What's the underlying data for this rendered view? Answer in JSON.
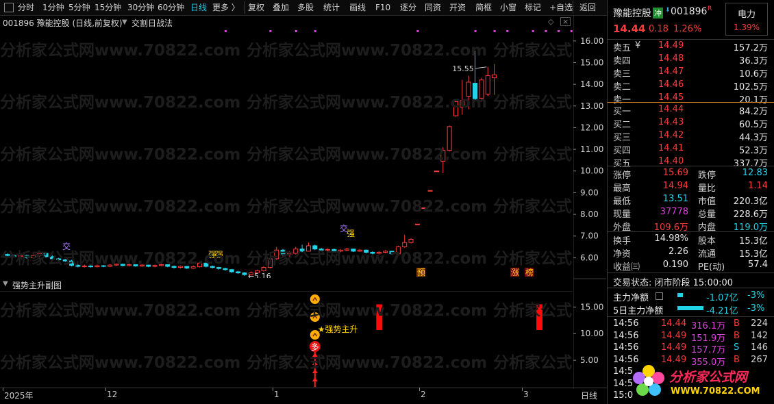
{
  "toolbar": {
    "items": [
      "分时",
      "1分钟",
      "5分钟",
      "15分钟",
      "30分钟",
      "60分钟",
      "日线",
      "更多 〉",
      "复权",
      "叠加",
      "多股",
      "统计",
      "画线",
      "F10",
      "逐分",
      "同资",
      "开资",
      "简框",
      "小窗",
      "标记",
      "+自选",
      "返回"
    ],
    "active": "日线"
  },
  "chart_header": {
    "code_title": "001896 豫能控股 (日线,前复权)",
    "indicator": "交割日战法"
  },
  "sub_header": {
    "title": "强势主升副图"
  },
  "watermark": "分析家公式网www.70822.com",
  "main_chart": {
    "y_ticks": [
      "16.00",
      "15.00",
      "14.00",
      "13.00",
      "12.00",
      "11.00",
      "10.00",
      "9.00",
      "8.00",
      "7.00",
      "6.00"
    ],
    "high_label": "15.55",
    "low_label": "5.16",
    "labels": {
      "jiao1": "交",
      "jiao2": "交",
      "qiang1": "强",
      "qiang2": "强",
      "qiang3": "强",
      "yu": "预",
      "zhang": "涨",
      "wan": "榜"
    }
  },
  "sub_chart": {
    "y_ticks": [
      "15.00",
      "10.00",
      "5.00"
    ],
    "signal_label": "★强势主升",
    "duo": "多"
  },
  "x_axis": {
    "labels": [
      "2025年",
      "12",
      "1",
      "2",
      "3"
    ],
    "period": "日线"
  },
  "quote": {
    "name": "豫能控股",
    "badge": "冲",
    "code": "001896",
    "r_mark": "R",
    "sector": "电力",
    "sector_pct": "1.39%",
    "price": "14.44",
    "change": "0.18",
    "pct": "1.26%",
    "asks": [
      {
        "label": "卖五",
        "mark": "¥",
        "price": "14.49",
        "vol": "157.2万"
      },
      {
        "label": "卖四",
        "mark": "",
        "price": "14.48",
        "vol": "36.3万"
      },
      {
        "label": "卖三",
        "mark": "",
        "price": "14.47",
        "vol": "10.6万"
      },
      {
        "label": "卖二",
        "mark": "",
        "price": "14.46",
        "vol": "102.5万"
      },
      {
        "label": "卖一",
        "mark": "",
        "price": "14.45",
        "vol": "20.1万"
      }
    ],
    "bids": [
      {
        "label": "买一",
        "price": "14.44",
        "vol": "84.2万"
      },
      {
        "label": "买二",
        "price": "14.43",
        "vol": "60.5万"
      },
      {
        "label": "买三",
        "price": "14.42",
        "vol": "44.3万"
      },
      {
        "label": "买四",
        "price": "14.41",
        "vol": "52.3万"
      },
      {
        "label": "买五",
        "price": "14.40",
        "vol": "337.7万"
      }
    ],
    "stats": [
      {
        "l1": "涨停",
        "v1": "15.69",
        "c1": "red",
        "l2": "跌停",
        "v2": "12.83",
        "c2": "green"
      },
      {
        "l1": "最高",
        "v1": "14.94",
        "c1": "red",
        "l2": "量比",
        "v2": "1.14",
        "c2": "red"
      },
      {
        "l1": "最低",
        "v1": "13.51",
        "c1": "green",
        "l2": "市值",
        "v2": "220.3亿",
        "c2": "white"
      },
      {
        "l1": "现量",
        "v1": "37778",
        "c1": "purple",
        "l2": "总量",
        "v2": "228.6万",
        "c2": "white"
      },
      {
        "l1": "外盘",
        "v1": "109.6万",
        "c1": "red",
        "l2": "内盘",
        "v2": "119.0万",
        "c2": "green"
      }
    ],
    "stats2": [
      {
        "l1": "换手",
        "v1": "14.98%",
        "l2": "股本",
        "v2": "15.3亿"
      },
      {
        "l1": "净资",
        "v1": "2.26",
        "l2": "流通",
        "v2": "15.3亿"
      },
      {
        "l1": "收益㈢",
        "v1": "0.190",
        "l2": "PE(动)",
        "v2": "57.4"
      }
    ],
    "status": "交易状态: 闭市阶段 15:00:00",
    "flow": [
      {
        "label": "主力净额",
        "value": "-1.07亿",
        "pct": "-3%",
        "bar": 0.2
      },
      {
        "label": "5日主力净额",
        "value": "-4.21亿",
        "pct": "-3%",
        "bar": 1.0
      }
    ],
    "ticks": [
      {
        "time": "14:56",
        "price": "14.44",
        "vol": "316.1万",
        "bs": "B",
        "n": "224",
        "pc": "red",
        "vc": "purple",
        "bc": "red"
      },
      {
        "time": "14:56",
        "price": "14.49",
        "vol": "151.9万",
        "bs": "B",
        "n": "142",
        "pc": "red",
        "vc": "purple",
        "bc": "red"
      },
      {
        "time": "14:56",
        "price": "14.49",
        "vol": "157.7万",
        "bs": "S",
        "n": "146",
        "pc": "red",
        "vc": "purple",
        "bc": "green"
      },
      {
        "time": "14:56",
        "price": "14.49",
        "vol": "355.0万",
        "bs": "B",
        "n": "267",
        "pc": "red",
        "vc": "purple",
        "bc": "red"
      },
      {
        "time": "14:5",
        "price": "",
        "vol": "",
        "bs": "",
        "n": "",
        "pc": "red",
        "vc": "purple",
        "bc": "red"
      },
      {
        "time": "14:5",
        "price": "",
        "vol": "",
        "bs": "",
        "n": "",
        "pc": "red",
        "vc": "purple",
        "bc": "red"
      },
      {
        "time": "15:0",
        "price": "",
        "vol": "",
        "bs": "",
        "n": "",
        "pc": "red",
        "vc": "purple",
        "bc": "red"
      }
    ],
    "logo_title": "分析家公式网",
    "logo_url": "WWW.70822.COM"
  },
  "colors": {
    "up": "#ff3a3a",
    "down": "#22d4e8",
    "bg": "#000000",
    "grid": "#1a1a1a",
    "accent": "#1ec8e6"
  },
  "chart_data": {
    "type": "candlestick",
    "title": "",
    "ylim": [
      5.0,
      16.5
    ],
    "candles": [
      {
        "o": 6.15,
        "c": 6.1,
        "h": 6.2,
        "l": 6.05
      },
      {
        "o": 6.1,
        "c": 6.05,
        "h": 6.15,
        "l": 6.0
      },
      {
        "o": 6.05,
        "c": 6.1,
        "h": 6.15,
        "l": 6.0
      },
      {
        "o": 6.1,
        "c": 6.0,
        "h": 6.15,
        "l": 5.95
      },
      {
        "o": 6.0,
        "c": 6.1,
        "h": 6.2,
        "l": 5.95
      },
      {
        "o": 6.1,
        "c": 6.2,
        "h": 6.3,
        "l": 6.0
      },
      {
        "o": 6.2,
        "c": 6.05,
        "h": 6.25,
        "l": 6.0
      },
      {
        "o": 6.05,
        "c": 5.95,
        "h": 6.1,
        "l": 5.9
      },
      {
        "o": 5.95,
        "c": 5.9,
        "h": 6.0,
        "l": 5.85
      },
      {
        "o": 5.9,
        "c": 5.85,
        "h": 5.95,
        "l": 5.8
      },
      {
        "o": 5.85,
        "c": 5.65,
        "h": 5.9,
        "l": 5.6
      },
      {
        "o": 5.65,
        "c": 5.6,
        "h": 5.7,
        "l": 5.55
      },
      {
        "o": 5.6,
        "c": 5.62,
        "h": 5.68,
        "l": 5.55
      },
      {
        "o": 5.62,
        "c": 5.58,
        "h": 5.66,
        "l": 5.55
      },
      {
        "o": 5.58,
        "c": 5.63,
        "h": 5.68,
        "l": 5.55
      },
      {
        "o": 5.63,
        "c": 5.6,
        "h": 5.66,
        "l": 5.56
      },
      {
        "o": 5.6,
        "c": 5.66,
        "h": 5.7,
        "l": 5.56
      },
      {
        "o": 5.66,
        "c": 5.7,
        "h": 5.74,
        "l": 5.62
      },
      {
        "o": 5.7,
        "c": 5.64,
        "h": 5.73,
        "l": 5.6
      },
      {
        "o": 5.64,
        "c": 5.68,
        "h": 5.72,
        "l": 5.6
      },
      {
        "o": 5.68,
        "c": 5.62,
        "h": 5.7,
        "l": 5.58
      },
      {
        "o": 5.62,
        "c": 5.66,
        "h": 5.7,
        "l": 5.58
      },
      {
        "o": 5.66,
        "c": 5.6,
        "h": 5.68,
        "l": 5.56
      },
      {
        "o": 5.6,
        "c": 5.64,
        "h": 5.68,
        "l": 5.56
      },
      {
        "o": 5.64,
        "c": 5.68,
        "h": 5.72,
        "l": 5.6
      },
      {
        "o": 5.68,
        "c": 5.6,
        "h": 5.7,
        "l": 5.56
      },
      {
        "o": 5.6,
        "c": 5.55,
        "h": 5.64,
        "l": 5.5
      },
      {
        "o": 5.55,
        "c": 5.6,
        "h": 5.64,
        "l": 5.5
      },
      {
        "o": 5.6,
        "c": 5.52,
        "h": 5.62,
        "l": 5.48
      },
      {
        "o": 5.52,
        "c": 5.58,
        "h": 5.64,
        "l": 5.48
      },
      {
        "o": 5.58,
        "c": 5.75,
        "h": 5.8,
        "l": 5.55
      },
      {
        "o": 5.75,
        "c": 5.6,
        "h": 5.78,
        "l": 5.55
      },
      {
        "o": 5.6,
        "c": 5.55,
        "h": 5.64,
        "l": 5.5
      },
      {
        "o": 5.55,
        "c": 5.5,
        "h": 5.58,
        "l": 5.45
      },
      {
        "o": 5.5,
        "c": 5.45,
        "h": 5.54,
        "l": 5.4
      },
      {
        "o": 5.45,
        "c": 5.35,
        "h": 5.48,
        "l": 5.3
      },
      {
        "o": 5.35,
        "c": 5.3,
        "h": 5.4,
        "l": 5.25
      },
      {
        "o": 5.3,
        "c": 5.22,
        "h": 5.34,
        "l": 5.16
      },
      {
        "o": 5.22,
        "c": 5.3,
        "h": 5.36,
        "l": 5.18
      },
      {
        "o": 5.3,
        "c": 5.4,
        "h": 5.45,
        "l": 5.26
      },
      {
        "o": 5.4,
        "c": 5.55,
        "h": 5.6,
        "l": 5.36
      },
      {
        "o": 5.55,
        "c": 5.95,
        "h": 6.0,
        "l": 5.5
      },
      {
        "o": 5.95,
        "c": 6.35,
        "h": 6.5,
        "l": 5.9
      },
      {
        "o": 6.35,
        "c": 6.15,
        "h": 6.4,
        "l": 6.0
      },
      {
        "o": 6.15,
        "c": 6.2,
        "h": 6.3,
        "l": 6.05
      },
      {
        "o": 6.2,
        "c": 6.4,
        "h": 6.5,
        "l": 6.15
      },
      {
        "o": 6.4,
        "c": 6.3,
        "h": 6.6,
        "l": 6.25
      },
      {
        "o": 6.3,
        "c": 6.55,
        "h": 6.7,
        "l": 6.28
      },
      {
        "o": 6.55,
        "c": 6.4,
        "h": 6.6,
        "l": 6.35
      },
      {
        "o": 6.4,
        "c": 6.35,
        "h": 6.45,
        "l": 6.3
      },
      {
        "o": 6.35,
        "c": 6.38,
        "h": 6.42,
        "l": 6.3
      },
      {
        "o": 6.38,
        "c": 6.3,
        "h": 6.42,
        "l": 6.25
      },
      {
        "o": 6.3,
        "c": 6.35,
        "h": 6.4,
        "l": 6.25
      },
      {
        "o": 6.35,
        "c": 6.4,
        "h": 6.45,
        "l": 6.3
      },
      {
        "o": 6.4,
        "c": 6.3,
        "h": 6.42,
        "l": 6.26
      },
      {
        "o": 6.3,
        "c": 6.35,
        "h": 6.4,
        "l": 6.26
      },
      {
        "o": 6.35,
        "c": 6.25,
        "h": 6.38,
        "l": 6.2
      },
      {
        "o": 6.25,
        "c": 6.2,
        "h": 6.3,
        "l": 6.15
      },
      {
        "o": 6.2,
        "c": 6.25,
        "h": 6.3,
        "l": 6.15
      },
      {
        "o": 6.25,
        "c": 6.3,
        "h": 6.35,
        "l": 6.2
      },
      {
        "o": 6.3,
        "c": 6.18,
        "h": 6.32,
        "l": 6.15
      },
      {
        "o": 6.18,
        "c": 6.5,
        "h": 6.55,
        "l": 6.15
      },
      {
        "o": 6.5,
        "c": 6.7,
        "h": 7.05,
        "l": 6.45
      },
      {
        "o": 6.7,
        "c": 6.85,
        "h": 6.9,
        "l": 6.65
      },
      {
        "o": 7.55,
        "c": 7.55,
        "h": 7.55,
        "l": 7.55
      },
      {
        "o": 8.3,
        "c": 8.3,
        "h": 8.3,
        "l": 8.3
      },
      {
        "o": 9.1,
        "c": 9.1,
        "h": 9.1,
        "l": 9.1
      },
      {
        "o": 10.0,
        "c": 10.0,
        "h": 10.0,
        "l": 10.0
      },
      {
        "o": 10.45,
        "c": 10.95,
        "h": 11.1,
        "l": 9.9
      },
      {
        "o": 10.95,
        "c": 12.05,
        "h": 12.1,
        "l": 10.9
      },
      {
        "o": 12.55,
        "c": 13.2,
        "h": 13.3,
        "l": 12.5
      },
      {
        "o": 12.95,
        "c": 13.25,
        "h": 14.2,
        "l": 12.6
      },
      {
        "o": 13.45,
        "c": 14.1,
        "h": 14.4,
        "l": 12.85
      },
      {
        "o": 14.05,
        "c": 13.25,
        "h": 15.55,
        "l": 13.2
      },
      {
        "o": 13.35,
        "c": 14.2,
        "h": 14.3,
        "l": 13.2
      },
      {
        "o": 13.55,
        "c": 14.4,
        "h": 14.8,
        "l": 13.45
      },
      {
        "o": 14.3,
        "c": 14.44,
        "h": 14.94,
        "l": 13.51
      }
    ],
    "sub_bars": [
      {
        "idx": 58,
        "value": 15.5
      },
      {
        "idx": 83,
        "value": 15.5
      },
      {
        "idx": 89,
        "value": 15.5
      }
    ]
  }
}
